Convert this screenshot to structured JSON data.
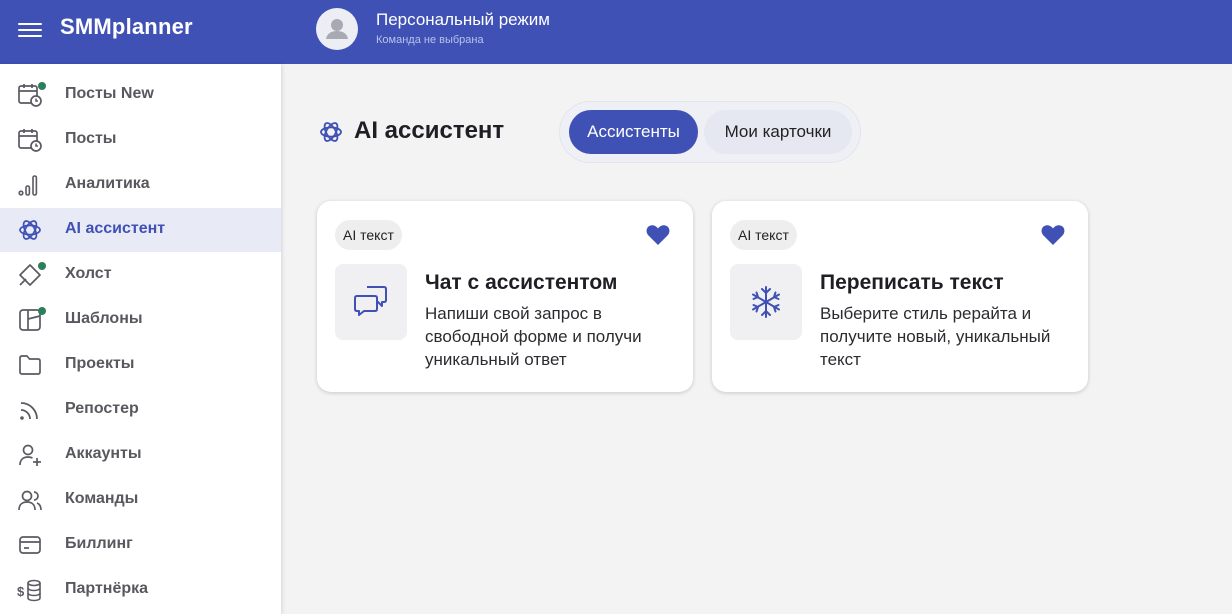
{
  "header": {
    "logo": "SMMplanner",
    "mode_title": "Персональный режим",
    "mode_subtitle": "Команда не выбрана"
  },
  "sidebar": {
    "items": [
      {
        "label": "Посты New",
        "icon": "calendar-clock-icon",
        "dot": true
      },
      {
        "label": "Посты",
        "icon": "calendar-clock-icon",
        "dot": false
      },
      {
        "label": "Аналитика",
        "icon": "bar-chart-icon",
        "dot": false
      },
      {
        "label": "AI ассистент",
        "icon": "openai-icon",
        "dot": false,
        "active": true
      },
      {
        "label": "Холст",
        "icon": "canvas-icon",
        "dot": true
      },
      {
        "label": "Шаблоны",
        "icon": "layout-icon",
        "dot": true
      },
      {
        "label": "Проекты",
        "icon": "folder-icon",
        "dot": false
      },
      {
        "label": "Репостер",
        "icon": "rss-icon",
        "dot": false
      },
      {
        "label": "Аккаунты",
        "icon": "user-plus-icon",
        "dot": false
      },
      {
        "label": "Команды",
        "icon": "users-icon",
        "dot": false
      },
      {
        "label": "Биллинг",
        "icon": "credit-card-icon",
        "dot": false
      },
      {
        "label": "Партнёрка",
        "icon": "coins-dollar-icon",
        "dot": false
      }
    ]
  },
  "main": {
    "title": "AI ассистент",
    "tabs": [
      {
        "label": "Ассистенты",
        "active": true
      },
      {
        "label": "Мои карточки",
        "active": false
      }
    ],
    "cards": [
      {
        "badge": "AI текст",
        "title": "Чат с ассистентом",
        "description": "Напиши свой запрос в свободной форме и получи уникальный ответ",
        "icon": "chat-bubbles-icon",
        "favorite": true
      },
      {
        "badge": "AI текст",
        "title": "Переписать текст",
        "description": "Выберите стиль рерайта и получите новый, уникальный текст",
        "icon": "snowflake-icon",
        "favorite": true
      }
    ]
  },
  "colors": {
    "primary": "#3f51b5",
    "active_bg": "#e8eaf6",
    "status_dot": "#2e7d5b",
    "page_bg": "#f3f3f4"
  }
}
